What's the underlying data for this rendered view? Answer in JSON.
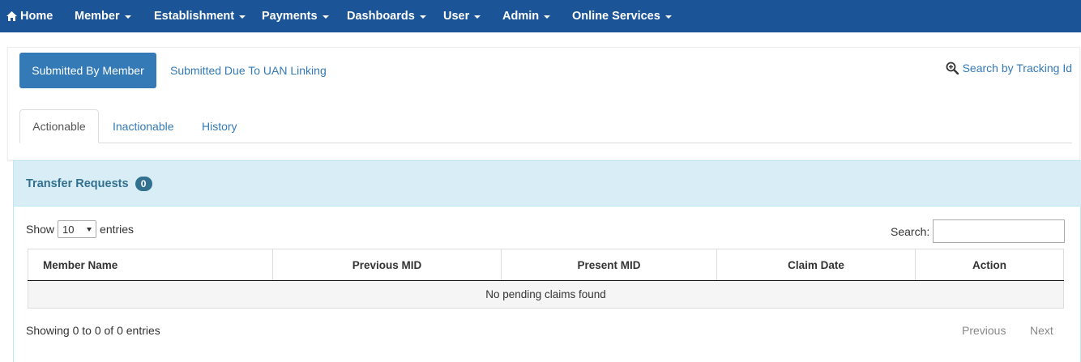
{
  "navbar": {
    "items": [
      {
        "label": "Home",
        "icon": "home-icon"
      },
      {
        "label": "Member"
      },
      {
        "label": "Establishment"
      },
      {
        "label": "Payments"
      },
      {
        "label": "Dashboards"
      },
      {
        "label": "User"
      },
      {
        "label": "Admin"
      },
      {
        "label": "Online Services"
      }
    ],
    "color": "#1b5598"
  },
  "submission_tabs": {
    "active": "Submitted By Member",
    "other": "Submitted Due To UAN Linking"
  },
  "search_tracking": {
    "label": "Search by Tracking Id",
    "icon": "zoom-in-icon"
  },
  "status_tabs": [
    "Actionable",
    "Inactionable",
    "History"
  ],
  "panel": {
    "title": "Transfer Requests",
    "count": "0"
  },
  "table_controls": {
    "show_label": "Show",
    "entries_value": "10",
    "entries_label": "entries",
    "search_label": "Search:",
    "search_value": ""
  },
  "table": {
    "columns": [
      "Member Name",
      "Previous MID",
      "Present MID",
      "Claim Date",
      "Action"
    ],
    "empty_message": "No pending claims found"
  },
  "footer": {
    "info": "Showing 0 to 0 of 0 entries",
    "previous": "Previous",
    "next": "Next"
  },
  "colors": {
    "accent": "#337ab7",
    "panel_bg": "#d9edf7",
    "panel_title": "#31708f"
  }
}
